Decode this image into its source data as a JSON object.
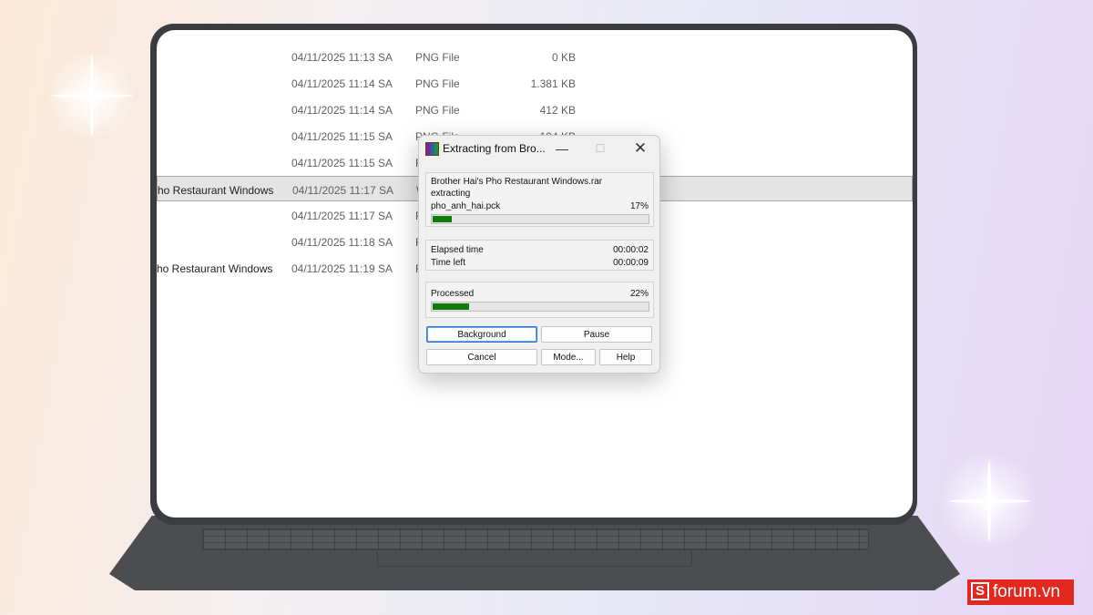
{
  "files": [
    {
      "name": "",
      "date": "04/11/2025 11:13 SA",
      "type": "PNG File",
      "size": "0 KB",
      "selected": false
    },
    {
      "name": "",
      "date": "04/11/2025 11:14 SA",
      "type": "PNG File",
      "size": "1.381 KB",
      "selected": false
    },
    {
      "name": "",
      "date": "04/11/2025 11:14 SA",
      "type": "PNG File",
      "size": "412 KB",
      "selected": false
    },
    {
      "name": "",
      "date": "04/11/2025 11:15 SA",
      "type": "PNG File",
      "size": "104 KB",
      "selected": false
    },
    {
      "name": "",
      "date": "04/11/2025 11:15 SA",
      "type": "F",
      "size": "",
      "selected": false
    },
    {
      "name": "ho Restaurant Windows",
      "date": "04/11/2025 11:17 SA",
      "type": "W",
      "size": "",
      "selected": true
    },
    {
      "name": "",
      "date": "04/11/2025 11:17 SA",
      "type": "F",
      "size": "",
      "selected": false
    },
    {
      "name": "",
      "date": "04/11/2025 11:18 SA",
      "type": "F",
      "size": "",
      "selected": false
    },
    {
      "name": "ho Restaurant Windows",
      "date": "04/11/2025 11:19 SA",
      "type": "F",
      "size": "",
      "selected": false
    }
  ],
  "dialog": {
    "title": "Extracting from Bro...",
    "archive": "Brother Hai's Pho Restaurant Windows.rar",
    "action": "extracting",
    "current_file": "pho_anh_hai.pck",
    "file_percent_label": "17%",
    "file_progress": 0.09,
    "elapsed_label": "Elapsed time",
    "elapsed_value": "00:00:02",
    "time_left_label": "Time left",
    "time_left_value": "00:00:09",
    "processed_label": "Processed",
    "processed_percent_label": "22%",
    "processed_progress": 0.17,
    "buttons": {
      "background": "Background",
      "pause": "Pause",
      "cancel": "Cancel",
      "mode": "Mode...",
      "help": "Help"
    },
    "titlebar": {
      "minimize": "—",
      "maximize": "☐",
      "close": "✕"
    }
  },
  "watermark": {
    "badge": "S",
    "text": "forum.vn"
  },
  "icons": [
    "winrar-icon",
    "minimize-icon",
    "maximize-icon",
    "close-icon"
  ],
  "colors": {
    "progress_fill": "#0f7b0f",
    "watermark_red": "#e2281f"
  }
}
